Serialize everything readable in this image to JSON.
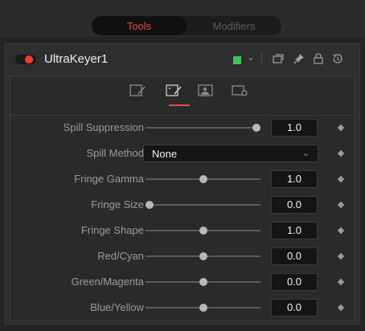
{
  "top_tabs": [
    {
      "label": "Tools",
      "active": true
    },
    {
      "label": "Modifiers",
      "active": false
    }
  ],
  "tool": {
    "name": "UltraKeyer1",
    "enabled": true,
    "color_swatch": "#3cc35a",
    "header_icons": [
      "chevron-down-icon",
      "versions-icon",
      "pin-icon",
      "lock-icon",
      "reset-icon"
    ]
  },
  "panel_tabs": [
    {
      "icon": "key-tab-icon",
      "active": false
    },
    {
      "icon": "matte-edit-tab-icon",
      "active": true
    },
    {
      "icon": "image-tab-icon",
      "active": false
    },
    {
      "icon": "settings-tab-icon",
      "active": false
    }
  ],
  "controls": [
    {
      "label": "Spill Suppression",
      "type": "slider",
      "value": "1.0",
      "fraction": 1.0
    },
    {
      "label": "Spill Method",
      "type": "dropdown",
      "value": "None"
    },
    {
      "label": "Fringe Gamma",
      "type": "slider",
      "value": "1.0",
      "fraction": 0.5
    },
    {
      "label": "Fringe Size",
      "type": "slider",
      "value": "0.0",
      "fraction": 0.0
    },
    {
      "label": "Fringe Shape",
      "type": "slider",
      "value": "1.0",
      "fraction": 0.5
    },
    {
      "label": "Red/Cyan",
      "type": "slider",
      "value": "0.0",
      "fraction": 0.5
    },
    {
      "label": "Green/Magenta",
      "type": "slider",
      "value": "0.0",
      "fraction": 0.5
    },
    {
      "label": "Blue/Yellow",
      "type": "slider",
      "value": "0.0",
      "fraction": 0.5
    }
  ],
  "colors": {
    "accent": "#e84a4a",
    "enabled_dot": "#ff3b30",
    "background": "#242424"
  }
}
